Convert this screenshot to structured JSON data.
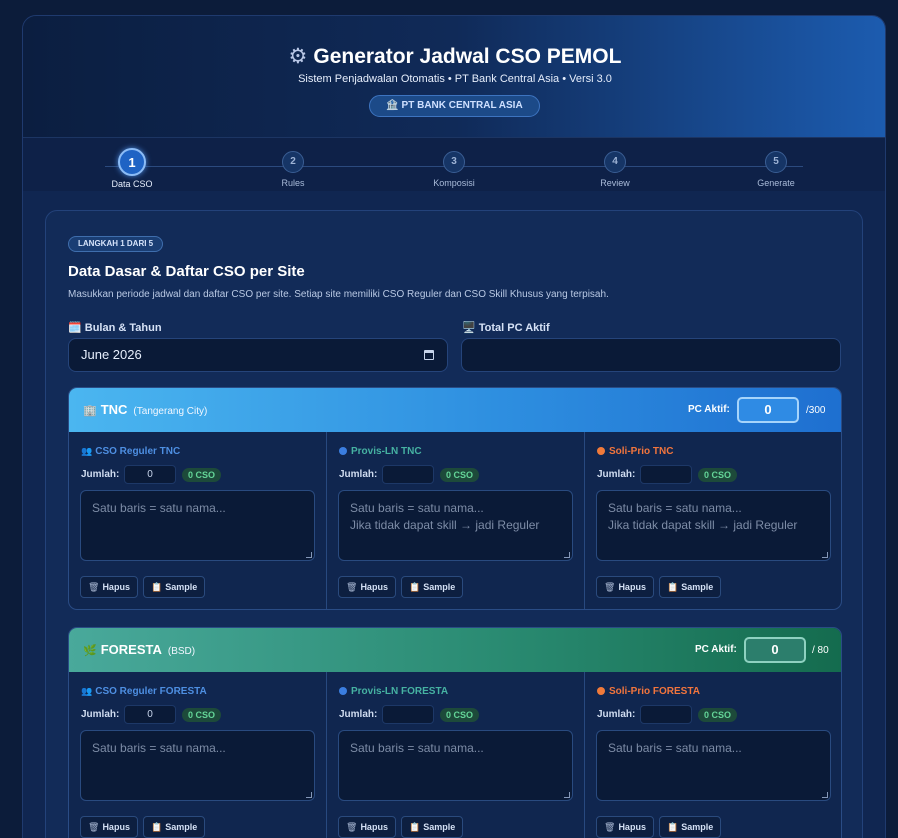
{
  "header": {
    "gear_icon": "⚙",
    "title": "Generator Jadwal CSO PEMOL",
    "subtitle": "Sistem Penjadwalan Otomatis • PT Bank Central Asia • Versi 3.0",
    "badge": "🏦 PT BANK CENTRAL ASIA"
  },
  "steps": [
    {
      "num": "1",
      "label": "Data CSO"
    },
    {
      "num": "2",
      "label": "Rules"
    },
    {
      "num": "3",
      "label": "Komposisi"
    },
    {
      "num": "4",
      "label": "Review"
    },
    {
      "num": "5",
      "label": "Generate"
    }
  ],
  "card": {
    "step_pill": "LANGKAH 1 DARI 5",
    "title": "Data Dasar & Daftar CSO per Site",
    "desc": "Masukkan periode jadwal dan daftar CSO per site. Setiap site memiliki CSO Reguler dan CSO Skill Khusus yang terpisah.",
    "month_label": "🗓️ Bulan & Tahun",
    "month_value": "June 2026",
    "pc_label": "🖥️ Total PC Aktif",
    "pc_value": ""
  },
  "sites": [
    {
      "icon": "🏢",
      "name": "TNC",
      "location": "(Tangerang City)",
      "pc_label": "PC Aktif:",
      "pc_value": "0",
      "pc_max": "/300",
      "cols": [
        {
          "title": "CSO Reguler TNC",
          "jumlah_label": "Jumlah:",
          "jumlah_value": "0",
          "cso": "0 CSO",
          "placeholder": "Satu baris = satu nama..."
        },
        {
          "title": "Provis-LN TNC",
          "jumlah_label": "Jumlah:",
          "jumlah_value": "",
          "cso": "0 CSO",
          "placeholder": "Satu baris = satu nama...\nJika tidak dapat skill → jadi Reguler"
        },
        {
          "title": "Soli-Prio TNC",
          "jumlah_label": "Jumlah:",
          "jumlah_value": "",
          "cso": "0 CSO",
          "placeholder": "Satu baris = satu nama...\nJika tidak dapat skill → jadi Reguler"
        }
      ]
    },
    {
      "icon": "🌿",
      "name": "FORESTA",
      "location": "(BSD)",
      "pc_label": "PC Aktif:",
      "pc_value": "0",
      "pc_max": "/ 80",
      "cols": [
        {
          "title": "CSO Reguler FORESTA",
          "jumlah_label": "Jumlah:",
          "jumlah_value": "0",
          "cso": "0 CSO",
          "placeholder": "Satu baris = satu nama..."
        },
        {
          "title": "Provis-LN FORESTA",
          "jumlah_label": "Jumlah:",
          "jumlah_value": "",
          "cso": "0 CSO",
          "placeholder": "Satu baris = satu nama..."
        },
        {
          "title": "Soli-Prio FORESTA",
          "jumlah_label": "Jumlah:",
          "jumlah_value": "",
          "cso": "0 CSO",
          "placeholder": "Satu baris = satu nama..."
        }
      ]
    }
  ],
  "buttons": {
    "hapus": "Hapus",
    "sample": "Sample",
    "hapus_icon": "🗑",
    "sample_icon": "📋"
  }
}
